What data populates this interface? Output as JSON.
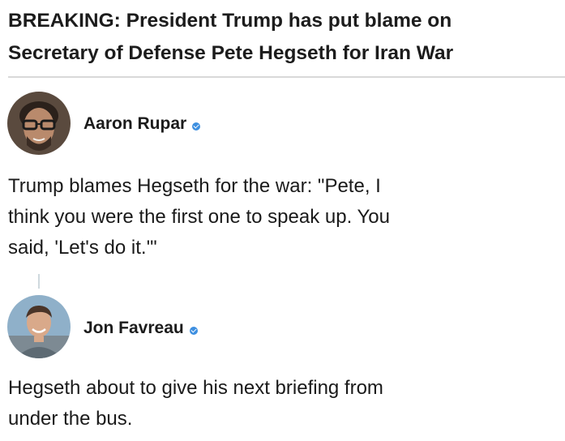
{
  "headline": {
    "lines": [
      "BREAKING: President Trump has put blame on",
      "Secretary of Defense Pete Hegseth for Iran War"
    ]
  },
  "posts": [
    {
      "author": "Aaron Rupar",
      "verified": true,
      "avatar_icon": "avatar-photo",
      "text_lines": [
        "Trump blames Hegseth for the war: \"Pete, I",
        "think you were the first one to speak up. You",
        "said, 'Let's do it.'\""
      ]
    },
    {
      "author": "Jon Favreau",
      "verified": true,
      "avatar_icon": "avatar-photo",
      "text_lines": [
        "Hegseth about to give his next briefing from",
        "under the bus."
      ]
    }
  ],
  "colors": {
    "verified_badge": "#3d8fe0",
    "divider": "#d9d9d9",
    "thread_line": "#cfd9de"
  }
}
